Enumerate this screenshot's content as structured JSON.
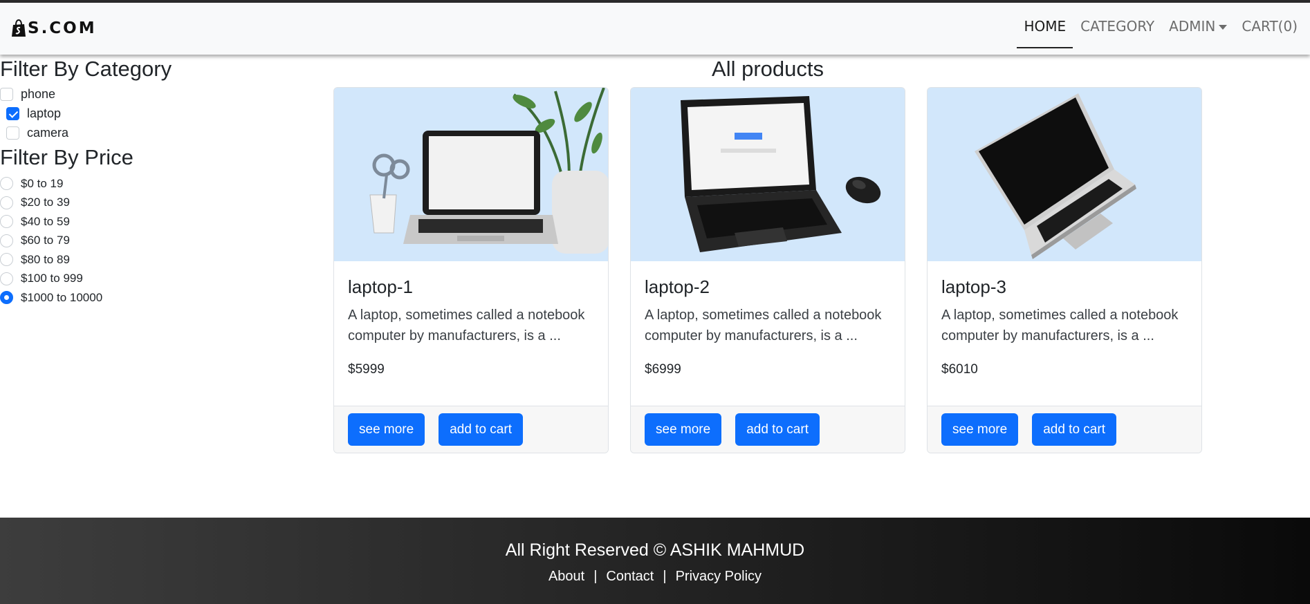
{
  "navbar": {
    "brand": "S.COM",
    "brand_icon": "shopify-bag-icon",
    "links": {
      "home": "HOME",
      "category": "CATEGORY",
      "admin": "ADMIN",
      "cart": "CART(0)"
    }
  },
  "sidebar": {
    "category_title": "Filter By Category",
    "categories": [
      {
        "label": "phone",
        "checked": false
      },
      {
        "label": "laptop",
        "checked": true
      },
      {
        "label": "camera",
        "checked": false
      }
    ],
    "price_title": "Filter By Price",
    "prices": [
      {
        "label": "$0 to 19",
        "checked": false
      },
      {
        "label": "$20 to 39",
        "checked": false
      },
      {
        "label": "$40 to 59",
        "checked": false
      },
      {
        "label": "$60 to 79",
        "checked": false
      },
      {
        "label": "$80 to 89",
        "checked": false
      },
      {
        "label": "$100 to 999",
        "checked": false
      },
      {
        "label": "$1000 to 10000",
        "checked": true
      }
    ]
  },
  "main": {
    "title": "All products",
    "products": [
      {
        "name": "laptop-1",
        "description": "A laptop, sometimes called a notebook computer by manufacturers, is a ...",
        "price": "$5999",
        "see_more": "see more",
        "add_to_cart": "add to cart",
        "image": "laptop-on-desk-photo"
      },
      {
        "name": "laptop-2",
        "description": "A laptop, sometimes called a notebook computer by manufacturers, is a ...",
        "price": "$6999",
        "see_more": "see more",
        "add_to_cart": "add to cart",
        "image": "black-laptop-with-mouse-photo"
      },
      {
        "name": "laptop-3",
        "description": "A laptop, sometimes called a notebook computer by manufacturers, is a ...",
        "price": "$6010",
        "see_more": "see more",
        "add_to_cart": "add to cart",
        "image": "silver-laptop-photo"
      }
    ]
  },
  "footer": {
    "copyright": "All Right Reserved © ASHIK MAHMUD",
    "links": {
      "about": "About",
      "contact": "Contact",
      "privacy": "Privacy Policy",
      "separator": "|"
    }
  },
  "colors": {
    "primary": "#0d6efd",
    "navbar_bg": "#f8f9fa",
    "image_bg": "#d3e8fb",
    "footer_dark": "#0a0a0a"
  }
}
